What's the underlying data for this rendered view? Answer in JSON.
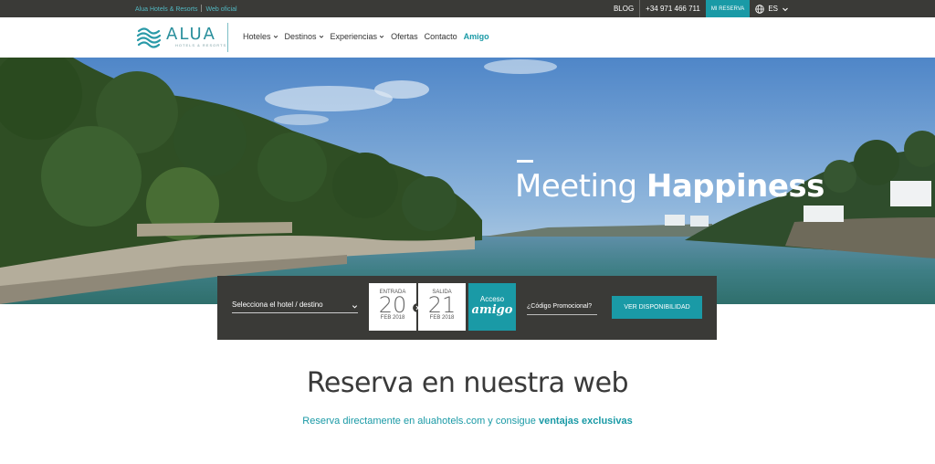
{
  "topbar": {
    "left_text_1": "Alua Hotels & Resorts",
    "left_text_2": "Web oficial",
    "blog": "BLOG",
    "phone": "+34 971 466 711",
    "mi_reserva": "MI RESERVA",
    "language": "ES",
    "language_icon": "globe-icon"
  },
  "header": {
    "brand": "ALUA",
    "brand_sub": "HOTELS & RESORTS",
    "logo_icon": "alua-wave-logo",
    "nav": [
      {
        "label": "Hoteles",
        "dropdown": true
      },
      {
        "label": "Destinos",
        "dropdown": true
      },
      {
        "label": "Experiencias",
        "dropdown": true
      },
      {
        "label": "Ofertas",
        "dropdown": false
      },
      {
        "label": "Contacto",
        "dropdown": false
      },
      {
        "label": "Amigo",
        "dropdown": false
      }
    ]
  },
  "hero": {
    "title_light": "Meeting",
    "title_bold": "Happiness"
  },
  "booking": {
    "hotel_placeholder": "Selecciona el hotel / destino",
    "checkin": {
      "label": "ENTRADA",
      "day": "20",
      "month": "FEB 2018"
    },
    "checkout": {
      "label": "SALIDA",
      "day": "21",
      "month": "FEB 2018"
    },
    "amigo_line1": "Acceso",
    "amigo_line2": "amigo",
    "promo_placeholder": "¿Código Promocional?",
    "submit": "VER DISPONIBILIDAD"
  },
  "content": {
    "title": "Reserva en nuestra web",
    "subtitle_normal": "Reserva directamente en aluahotels.com y consigue",
    "subtitle_bold": "ventajas exclusivas"
  },
  "colors": {
    "accent": "#1a9aa6",
    "dark": "#3a3a37"
  }
}
